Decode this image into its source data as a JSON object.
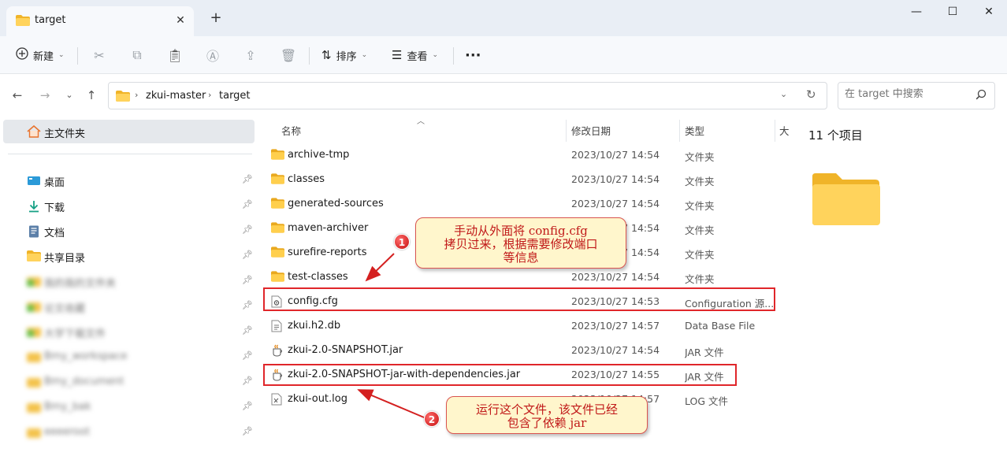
{
  "tab": {
    "title": "target",
    "close": "✕",
    "new": "+"
  },
  "window": {
    "minimize": "—",
    "maximize": "☐",
    "close": "✕"
  },
  "toolbar": {
    "new_label": "新建",
    "sort_label": "排序",
    "view_label": "查看",
    "more": "···"
  },
  "address": {
    "crumbs": [
      "zkui-master",
      "target"
    ]
  },
  "search": {
    "placeholder": "在 target 中搜索"
  },
  "sidebar": {
    "home": "主文件夹",
    "items": [
      {
        "label": "桌面",
        "icon": "desktop-icon"
      },
      {
        "label": "下载",
        "icon": "download-icon"
      },
      {
        "label": "文档",
        "icon": "document-icon"
      },
      {
        "label": "共享目录",
        "icon": "folder-icon"
      },
      {
        "label": "我的我的文件夹",
        "icon": "folder-green-icon",
        "blurred": true
      },
      {
        "label": "论文收藏",
        "icon": "folder-green-icon",
        "blurred": true
      },
      {
        "label": "大学下载文件",
        "icon": "folder-green-icon",
        "blurred": true
      },
      {
        "label": "Bmy_workspace",
        "icon": "folder-icon",
        "blurred": true
      },
      {
        "label": "Bmy_document",
        "icon": "folder-icon",
        "blurred": true
      },
      {
        "label": "Bmy_bak",
        "icon": "folder-icon",
        "blurred": true
      },
      {
        "label": "eeeeroot",
        "icon": "folder-icon",
        "blurred": true
      }
    ]
  },
  "columns": {
    "name": "名称",
    "date": "修改日期",
    "type": "类型",
    "size": "大"
  },
  "files": [
    {
      "name": "archive-tmp",
      "date": "2023/10/27 14:54",
      "type": "文件夹",
      "icon": "folder-icon"
    },
    {
      "name": "classes",
      "date": "2023/10/27 14:54",
      "type": "文件夹",
      "icon": "folder-icon"
    },
    {
      "name": "generated-sources",
      "date": "2023/10/27 14:54",
      "type": "文件夹",
      "icon": "folder-icon"
    },
    {
      "name": "maven-archiver",
      "date": "2023/10/27 14:54",
      "type": "文件夹",
      "icon": "folder-icon"
    },
    {
      "name": "surefire-reports",
      "date": "2023/10/27 14:54",
      "type": "文件夹",
      "icon": "folder-icon"
    },
    {
      "name": "test-classes",
      "date": "2023/10/27 14:54",
      "type": "文件夹",
      "icon": "folder-icon"
    },
    {
      "name": "config.cfg",
      "date": "2023/10/27 14:53",
      "type": "Configuration 源...",
      "icon": "config-file-icon"
    },
    {
      "name": "zkui.h2.db",
      "date": "2023/10/27 14:57",
      "type": "Data Base File",
      "icon": "db-file-icon"
    },
    {
      "name": "zkui-2.0-SNAPSHOT.jar",
      "date": "2023/10/27 14:54",
      "type": "JAR 文件",
      "icon": "jar-icon"
    },
    {
      "name": "zkui-2.0-SNAPSHOT-jar-with-dependencies.jar",
      "date": "2023/10/27 14:55",
      "type": "JAR 文件",
      "icon": "jar-icon"
    },
    {
      "name": "zkui-out.log",
      "date": "2023/10/27 14:57",
      "type": "LOG 文件",
      "icon": "log-file-icon"
    }
  ],
  "details": {
    "count": "11 个项目"
  },
  "annotations": {
    "callout1": {
      "badge": "1",
      "lines": [
        "手动从外面将 config.cfg",
        "拷贝过来，根据需要修改端口",
        "等信息"
      ]
    },
    "callout2": {
      "badge": "2",
      "lines": [
        "运行这个文件，该文件已经",
        "包含了依赖 jar"
      ]
    }
  }
}
